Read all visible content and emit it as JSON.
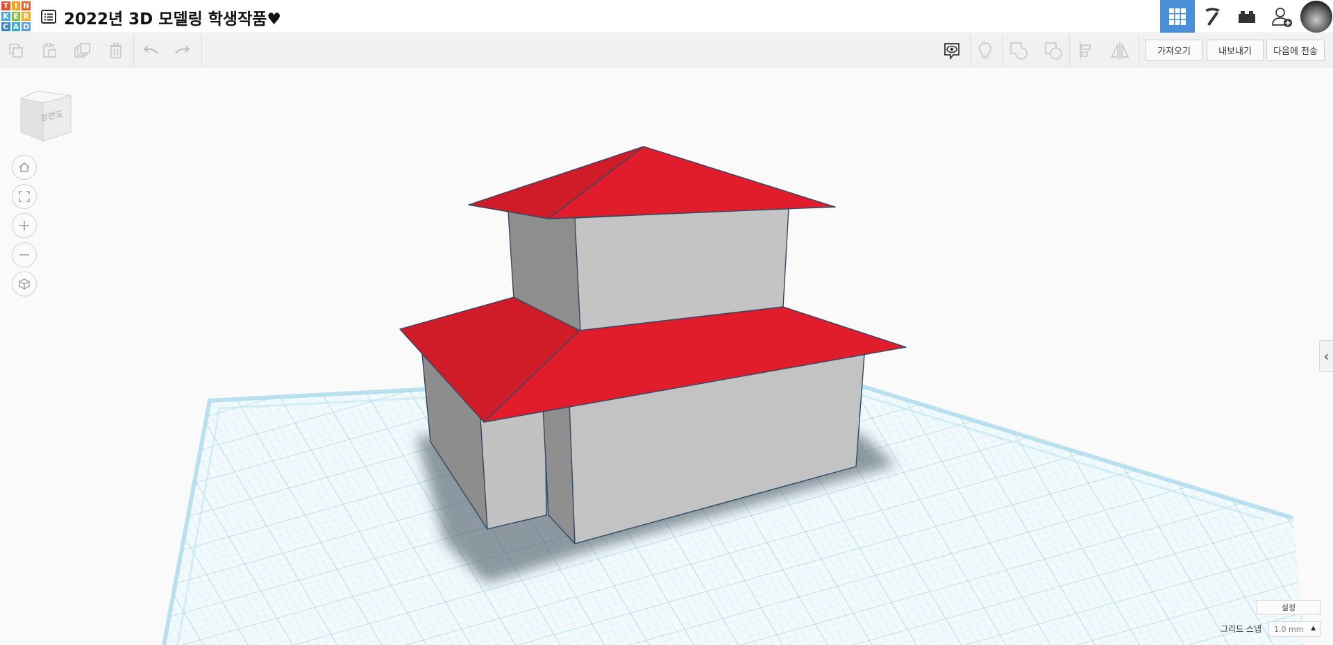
{
  "logo": {
    "letters": [
      "T",
      "I",
      "N",
      "K",
      "E",
      "R",
      "C",
      "A",
      "D"
    ]
  },
  "project": {
    "title": "2022년 3D 모델링 학생작품♥"
  },
  "topnav": {
    "items": [
      "3d-design-view",
      "minecraft-view",
      "brick-view",
      "invite-user"
    ]
  },
  "toolbar": {
    "import_label": "가져오기",
    "export_label": "내보내기",
    "send_to_label": "다음에 전송"
  },
  "viewcube": {
    "label": "정면도"
  },
  "bottom": {
    "settings_label": "설정",
    "grid_snap_label": "그리드 스냅",
    "grid_snap_value": "1.0 mm"
  },
  "colors": {
    "roof_red": "#e11d2c",
    "roof_red_dark": "#cf1c28",
    "wall_light": "#c3c3c3",
    "wall_dark": "#8d8d8d",
    "grid_blue": "#a9dcee",
    "accent_blue": "#4a90d9"
  }
}
